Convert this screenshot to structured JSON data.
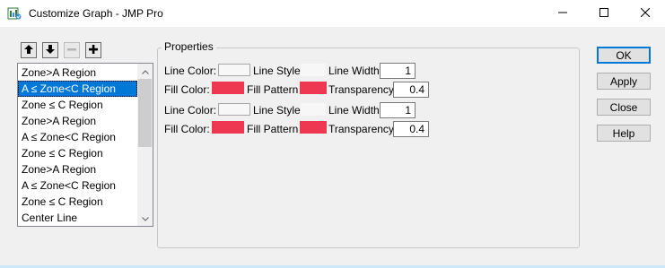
{
  "window": {
    "title": "Customize Graph - JMP Pro",
    "minimize_icon": "minimize-icon",
    "maximize_icon": "maximize-icon",
    "close_icon": "close-icon"
  },
  "toolbar": {
    "move_up_icon": "arrow-up-icon",
    "move_down_icon": "arrow-down-icon",
    "remove_icon": "minus-icon",
    "add_icon": "plus-icon"
  },
  "list": {
    "items": [
      "Zone>A Region",
      "A ≤ Zone<C Region",
      "Zone ≤ C Region",
      "Zone>A Region",
      "A ≤ Zone<C Region",
      "Zone ≤ C Region",
      "Zone>A Region",
      "A ≤ Zone<C Region",
      "Zone ≤ C Region",
      "Center Line"
    ],
    "selected_index": 1
  },
  "properties": {
    "group_label": "Properties",
    "rows": [
      {
        "line_color_label": "Line Color:",
        "line_style_label": "Line Style:",
        "line_width_label": "Line Width",
        "line_width_value": "1",
        "fill_color_label": "Fill Color:",
        "fill_pattern_label": "Fill Pattern",
        "transparency_label": "Transparency",
        "transparency_value": "0.4"
      },
      {
        "line_color_label": "Line Color:",
        "line_style_label": "Line Style:",
        "line_width_label": "Line Width",
        "line_width_value": "1",
        "fill_color_label": "Fill Color:",
        "fill_pattern_label": "Fill Pattern",
        "transparency_label": "Transparency",
        "transparency_value": "0.4"
      }
    ]
  },
  "buttons": {
    "ok": "OK",
    "apply": "Apply",
    "close": "Close",
    "help": "Help"
  },
  "colors": {
    "fill_swatch": "#ee3851",
    "line_swatch": "#f7f7f7",
    "selection": "#0078d7"
  }
}
